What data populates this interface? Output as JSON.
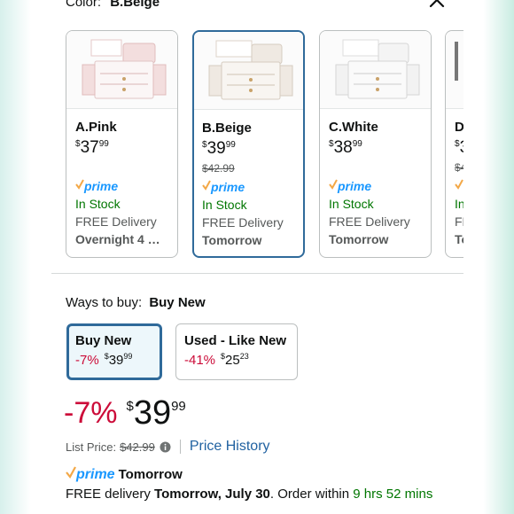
{
  "header": {
    "color_label": "Color:",
    "color_value": "B.Beige"
  },
  "swatches": [
    {
      "name": "A.Pink",
      "price_symbol": "$",
      "price_whole": "37",
      "price_cents": "99",
      "list_price": "",
      "prime": "prime",
      "stock": "In Stock",
      "delivery": "FREE Delivery",
      "when": "Overnight 4 …",
      "selected": false,
      "box_color": "#f3dede"
    },
    {
      "name": "B.Beige",
      "price_symbol": "$",
      "price_whole": "39",
      "price_cents": "99",
      "list_price": "$42.99",
      "prime": "prime",
      "stock": "In Stock",
      "delivery": "FREE Delivery",
      "when": "Tomorrow",
      "selected": true,
      "box_color": "#efe9e2"
    },
    {
      "name": "C.White",
      "price_symbol": "$",
      "price_whole": "38",
      "price_cents": "99",
      "list_price": "",
      "prime": "prime",
      "stock": "In Stock",
      "delivery": "FREE Delivery",
      "when": "Tomorrow",
      "selected": false,
      "box_color": "#f2f2f2"
    },
    {
      "name": "D",
      "price_symbol": "$",
      "price_whole": "3",
      "price_cents": "",
      "list_price": "$4",
      "prime": "",
      "stock": "In",
      "delivery": "FR",
      "when": "To",
      "selected": false,
      "box_color": "#e8e8e8"
    }
  ],
  "ways": {
    "label": "Ways to buy:",
    "value": "Buy New"
  },
  "buy_options": [
    {
      "title": "Buy New",
      "discount": "-7%",
      "price_symbol": "$",
      "price_whole": "39",
      "price_cents": "99"
    },
    {
      "title": "Used - Like New",
      "discount": "-41%",
      "price_symbol": "$",
      "price_whole": "25",
      "price_cents": "23"
    }
  ],
  "main_price": {
    "discount": "-7%",
    "symbol": "$",
    "whole": "39",
    "cents": "99"
  },
  "list_price": {
    "label": "List Price:",
    "value": "$42.99",
    "history_link": "Price History"
  },
  "delivery": {
    "prime": "prime",
    "prime_when": "Tomorrow",
    "line_prefix": "FREE delivery ",
    "line_date": "Tomorrow, July 30",
    "line_mid": ". Order within ",
    "line_time": "9 hrs 52 mins"
  },
  "colors": {
    "accent": "#2f6a9a",
    "prime_blue": "#1a98ff",
    "in_stock": "#007600",
    "discount": "#cc0c39",
    "link": "#2162a1"
  }
}
